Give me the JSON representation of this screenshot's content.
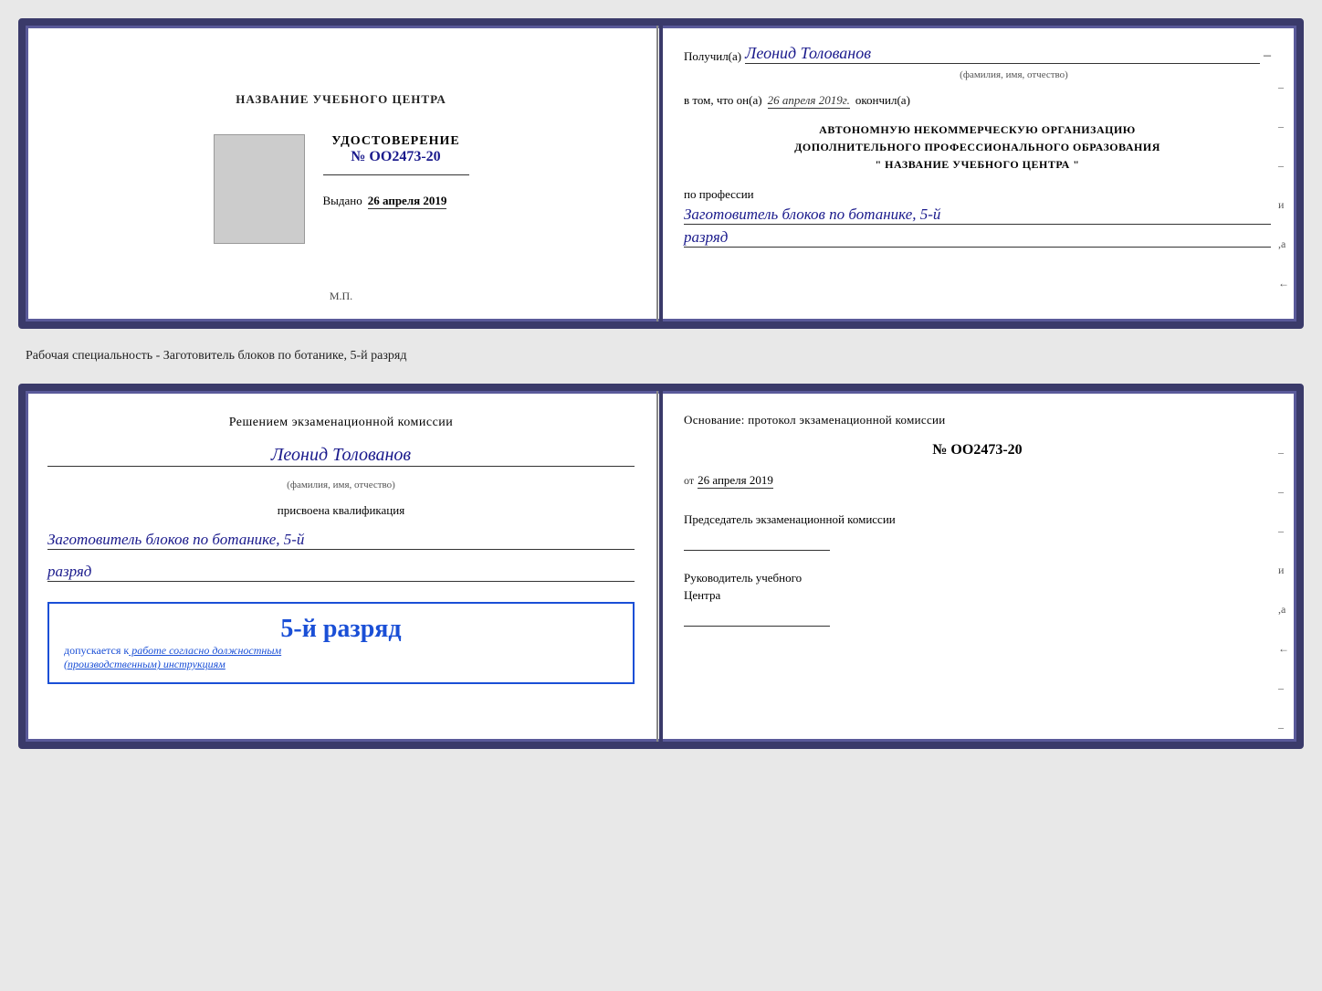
{
  "top_doc": {
    "left": {
      "training_center": "НАЗВАНИЕ УЧЕБНОГО ЦЕНТРА",
      "cert_title": "УДОСТОВЕРЕНИЕ",
      "cert_number": "№ OO2473-20",
      "issued_label": "Выдано",
      "issued_date": "26 апреля 2019",
      "stamp_label": "М.П."
    },
    "right": {
      "received_label": "Получил(а)",
      "recipient_name": "Леонид Толованов",
      "dash": "–",
      "fio_label": "(фамилия, имя, отчество)",
      "completed_prefix": "в том, что он(а)",
      "completed_date": "26 апреля 2019г.",
      "completed_suffix": "окончил(а)",
      "org_line1": "АВТОНОМНУЮ НЕКОММЕРЧЕСКУЮ ОРГАНИЗАЦИЮ",
      "org_line2": "ДОПОЛНИТЕЛЬНОГО ПРОФЕССИОНАЛЬНОГО ОБРАЗОВАНИЯ",
      "org_line3": "\"  НАЗВАНИЕ УЧЕБНОГО ЦЕНТРА  \"",
      "profession_label": "по профессии",
      "profession_name": "Заготовитель блоков по ботанике, 5-й",
      "rank": "разряд"
    }
  },
  "doc_label": "Рабочая специальность - Заготовитель блоков по ботанике, 5-й разряд",
  "bottom_doc": {
    "left": {
      "decision_line1": "Решением экзаменационной комиссии",
      "person_name": "Леонид Толованов",
      "fio_label": "(фамилия, имя, отчество)",
      "qualification_label": "присвоена квалификация",
      "qualification_name": "Заготовитель блоков по ботанике, 5-й",
      "rank": "разряд",
      "stamp_rank": "5-й разряд",
      "stamp_allowed_prefix": "допускается к",
      "stamp_allowed_italic": " работе согласно должностным",
      "stamp_allowed_line2": "(производственным) инструкциям"
    },
    "right": {
      "basis_label": "Основание: протокол экзаменационной комиссии",
      "cert_number": "№  OO2473-20",
      "date_prefix": "от",
      "date_value": "26 апреля 2019",
      "chair_title": "Председатель экзаменационной комиссии",
      "director_title_line1": "Руководитель учебного",
      "director_title_line2": "Центра"
    }
  },
  "right_marks": [
    "–",
    "–",
    "–",
    "и",
    ",а",
    "←",
    "–",
    "–",
    "–",
    "–",
    "–"
  ]
}
